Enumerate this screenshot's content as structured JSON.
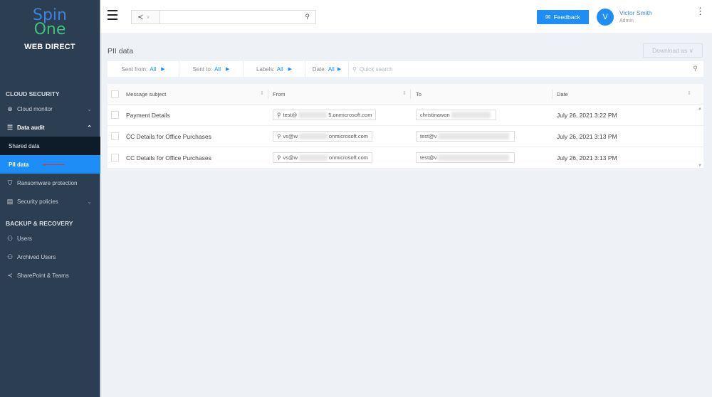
{
  "brand": {
    "line1": "Spin",
    "line2": "One",
    "subtitle": "WEB DIRECT"
  },
  "sidebar": {
    "sections": [
      {
        "title": "CLOUD SECURITY"
      },
      {
        "title": "BACKUP & RECOVERY"
      }
    ],
    "items": [
      {
        "label": "Cloud monitor",
        "icon": "globe-icon",
        "glyph": "⊕",
        "chevron": "⌄"
      },
      {
        "label": "Data audit",
        "icon": "document-icon",
        "glyph": "☰",
        "chevron": "⌃"
      },
      {
        "label": "Shared data"
      },
      {
        "label": "PII data"
      },
      {
        "label": "Ransomware protection",
        "icon": "shield-icon",
        "glyph": "⛉"
      },
      {
        "label": "Security policies",
        "icon": "policy-icon",
        "glyph": "▤",
        "chevron": "⌄"
      },
      {
        "label": "Users",
        "icon": "users-icon",
        "glyph": "⚇"
      },
      {
        "label": "Archived Users",
        "icon": "archived-users-icon",
        "glyph": "⚇"
      },
      {
        "label": "SharePoint & Teams",
        "icon": "share-icon",
        "glyph": "≺"
      }
    ]
  },
  "topbar": {
    "share_glyph": "≺",
    "chevron": "∨",
    "search_value": "",
    "search_glyph": "⚲",
    "feedback_label": "Feedback",
    "envelope_glyph": "✉",
    "avatar_initial": "V",
    "user_name": "Victor Smith",
    "user_role": "Admin",
    "kebab": "⋮"
  },
  "page": {
    "title": "PII data",
    "download_label": "Download as ∨"
  },
  "filters": [
    {
      "label": "Sent from:",
      "value": "All"
    },
    {
      "label": "Sent to:",
      "value": "All"
    },
    {
      "label": "Labels:",
      "value": "All"
    },
    {
      "label": "Date:",
      "value": "All"
    }
  ],
  "filter_triangle": "▶",
  "quick_search": {
    "placeholder": "Quick search",
    "glyph": "⚲"
  },
  "table": {
    "columns": [
      "Message subject",
      "From",
      "To",
      "Date"
    ],
    "sort_glyph": "⇕",
    "rows": [
      {
        "subject": "Payment Details",
        "from_prefix": "test@",
        "from_suffix": "5.onmicrosoft.com",
        "to_prefix": "christinawon",
        "date": "July 26, 2021 3:22 PM"
      },
      {
        "subject": "CC Details for Office Purchases",
        "from_prefix": "vs@w",
        "from_suffix": "onmicrosoft.com",
        "to_prefix": "test@v",
        "date": "July 26, 2021 3:13 PM"
      },
      {
        "subject": "CC Details for Office Purchases",
        "from_prefix": "vs@w",
        "from_suffix": "onmicrosoft.com",
        "to_prefix": "test@v",
        "date": "July 26, 2021 3:13 PM"
      }
    ]
  },
  "colors": {
    "accent": "#1e8df5",
    "sidebar": "#2c3e52",
    "background": "#eef1f5"
  }
}
